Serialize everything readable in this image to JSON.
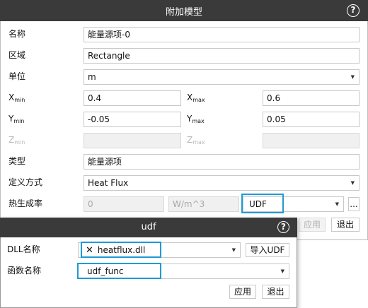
{
  "main": {
    "title": "附加模型",
    "help_glyph": "?",
    "name_label": "名称",
    "name_value": "能量源项-0",
    "region_label": "区域",
    "region_value": "Rectangle",
    "unit_label": "单位",
    "unit_value": "m",
    "xmin_label": "X",
    "xmin_sub": "min",
    "xmin_value": "0.4",
    "xmax_label": "X",
    "xmax_sub": "max",
    "xmax_value": "0.6",
    "ymin_label": "Y",
    "ymin_sub": "min",
    "ymin_value": "-0.05",
    "ymax_label": "Y",
    "ymax_sub": "max",
    "ymax_value": "0.05",
    "zmin_label": "Z",
    "zmin_sub": "min",
    "zmax_label": "Z",
    "zmax_sub": "max",
    "type_label": "类型",
    "type_value": "能量源项",
    "method_label": "定义方式",
    "method_value": "Heat Flux",
    "rate_label": "热生成率",
    "rate_value": "0",
    "rate_unit": "W/m^3",
    "rate_source": "UDF",
    "more_label": "...",
    "apply_label": "应用",
    "exit_label": "退出"
  },
  "udf": {
    "title": "udf",
    "help_glyph": "?",
    "dll_label": "DLL名称",
    "dll_value": "heatflux.dll",
    "import_label": "导入UDF",
    "func_label": "函数名称",
    "func_value": "udf_func",
    "apply_label": "应用",
    "exit_label": "退出"
  }
}
